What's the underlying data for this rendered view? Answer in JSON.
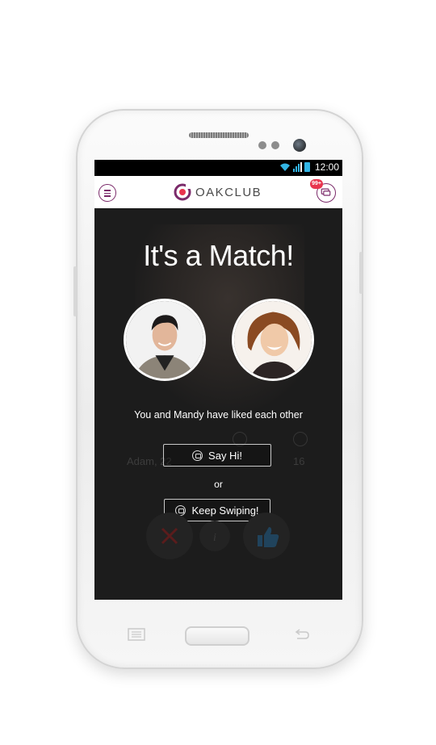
{
  "status_bar": {
    "time": "12:00"
  },
  "header": {
    "brand": "OAKCLUB",
    "notification_badge": "99+",
    "accent_color": "#7b2a6a"
  },
  "match": {
    "title": "It's a Match!",
    "subtitle": "You and Mandy have liked each other",
    "say_hi_label": "Say Hi!",
    "or_label": "or",
    "keep_swiping_label": "Keep Swiping!"
  },
  "background_profile": {
    "name_age": "Adam, 22",
    "count": "16"
  },
  "icons": {
    "menu": "menu-icon",
    "chat": "chat-icon",
    "dislike": "x-icon",
    "like": "thumbs-up-icon",
    "info": "info-icon"
  }
}
